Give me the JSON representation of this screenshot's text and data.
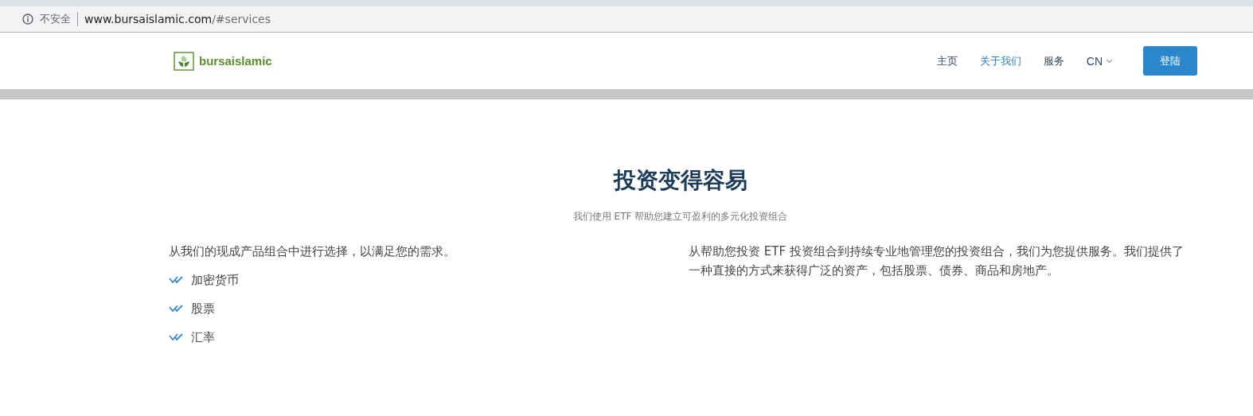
{
  "browser": {
    "security_label": "不安全",
    "url_host": "www.bursaislamic.com",
    "url_path": "/#services"
  },
  "header": {
    "logo_text": "bursaislamic",
    "nav": [
      {
        "label": "主页",
        "selected": false
      },
      {
        "label": "关于我们",
        "selected": true
      },
      {
        "label": "服务",
        "selected": false
      }
    ],
    "language": "CN",
    "login_button": "登陆"
  },
  "section": {
    "title": "投资变得容易",
    "subtitle": "我们使用 ETF 帮助您建立可盈利的多元化投资组合",
    "left_intro": "从我们的现成产品组合中进行选择，以满足您的需求。",
    "features": [
      "加密货币",
      "股票",
      "汇率"
    ],
    "right_text": "从帮助您投资 ETF 投资组合到持续专业地管理您的投资组合，我们为您提供服务。我们提供了一种直接的方式来获得广泛的资产，包括股票、债券、商品和房地产。"
  }
}
